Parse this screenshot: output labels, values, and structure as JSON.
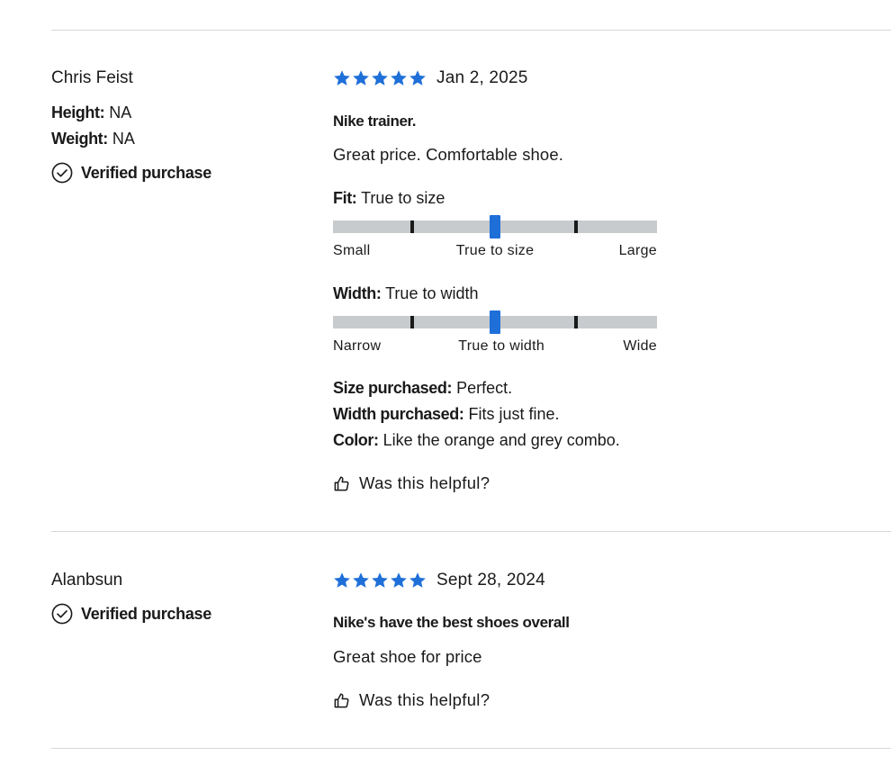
{
  "colors": {
    "star": "#1f6fd9",
    "marker": "#1f6fd9",
    "track": "#c7cbcd",
    "divider": "#d7d7d7"
  },
  "reviews": [
    {
      "author": "Chris Feist",
      "height_label": "Height:",
      "height_value": "NA",
      "weight_label": "Weight:",
      "weight_value": "NA",
      "verified": "Verified purchase",
      "rating": 5,
      "date": "Jan 2, 2025",
      "title": "Nike trainer.",
      "body": "Great price. Comfortable shoe.",
      "fit": {
        "label": "Fit:",
        "value": "True to size",
        "position": 0.5,
        "scale_left": "Small",
        "scale_mid": "True to size",
        "scale_right": "Large"
      },
      "width": {
        "label": "Width:",
        "value": "True to width",
        "position": 0.5,
        "scale_left": "Narrow",
        "scale_mid": "True to width",
        "scale_right": "Wide"
      },
      "size_purchased_label": "Size purchased:",
      "size_purchased_value": "Perfect.",
      "width_purchased_label": "Width purchased:",
      "width_purchased_value": "Fits just fine.",
      "color_label": "Color:",
      "color_value": "Like the orange and grey combo.",
      "helpful": "Was this helpful?",
      "icons": {
        "verified": "check-circle-icon",
        "star": "star-icon",
        "helpful": "thumbs-up-icon"
      }
    },
    {
      "author": "Alanbsun",
      "verified": "Verified purchase",
      "rating": 5,
      "date": "Sept 28, 2024",
      "title": "Nike's have the best shoes overall",
      "body": "Great shoe for price",
      "helpful": "Was this helpful?",
      "icons": {
        "verified": "check-circle-icon",
        "star": "star-icon",
        "helpful": "thumbs-up-icon"
      }
    }
  ]
}
